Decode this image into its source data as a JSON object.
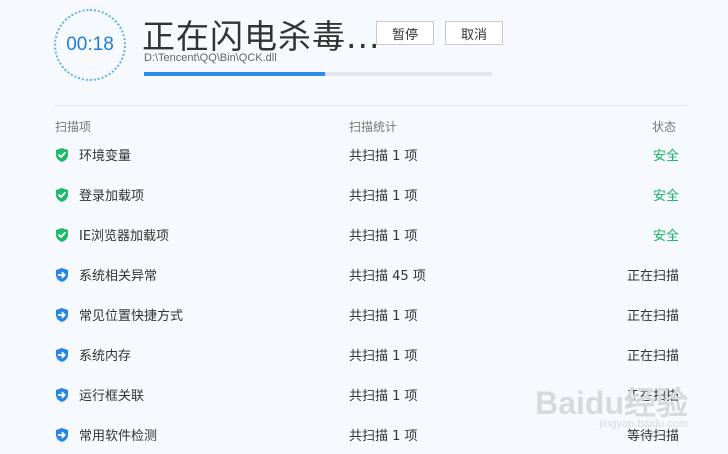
{
  "header": {
    "timer": "00:18",
    "title": "正在闪电杀毒...",
    "pause_label": "暂停",
    "cancel_label": "取消",
    "current_file": "D:\\Tencent\\QQ\\Bin\\QCK.dll",
    "progress": 0.52
  },
  "columns": {
    "item": "扫描项",
    "stat": "扫描统计",
    "state": "状态"
  },
  "rows": [
    {
      "name": "环境变量",
      "stat": "共扫描 1 项",
      "state": "安全",
      "icon": "green-shield-check-icon",
      "kind": "safe"
    },
    {
      "name": "登录加载项",
      "stat": "共扫描 1 项",
      "state": "安全",
      "icon": "green-shield-check-icon",
      "kind": "safe"
    },
    {
      "name": "IE浏览器加载项",
      "stat": "共扫描 1 项",
      "state": "安全",
      "icon": "green-shield-check-icon",
      "kind": "safe"
    },
    {
      "name": "系统相关异常",
      "stat": "共扫描 45 项",
      "state": "正在扫描",
      "icon": "blue-shield-arrow-icon",
      "kind": "scanning"
    },
    {
      "name": "常见位置快捷方式",
      "stat": "共扫描 1 项",
      "state": "正在扫描",
      "icon": "blue-shield-arrow-icon",
      "kind": "scanning"
    },
    {
      "name": "系统内存",
      "stat": "共扫描 1 项",
      "state": "正在扫描",
      "icon": "blue-shield-arrow-icon",
      "kind": "scanning"
    },
    {
      "name": "运行框关联",
      "stat": "共扫描 1 项",
      "state": "正在扫描",
      "icon": "blue-shield-arrow-icon",
      "kind": "scanning"
    },
    {
      "name": "常用软件检测",
      "stat": "共扫描 1 项",
      "state": "等待扫描",
      "icon": "blue-shield-arrow-icon",
      "kind": "scanning"
    }
  ],
  "colors": {
    "safe": "#19b16b",
    "accent": "#2e8ce8",
    "shield_green": "#21b96b",
    "shield_blue": "#2a86e6"
  },
  "watermark": {
    "main": "Baidu经验",
    "sub": "jingyan.baidu.com"
  }
}
